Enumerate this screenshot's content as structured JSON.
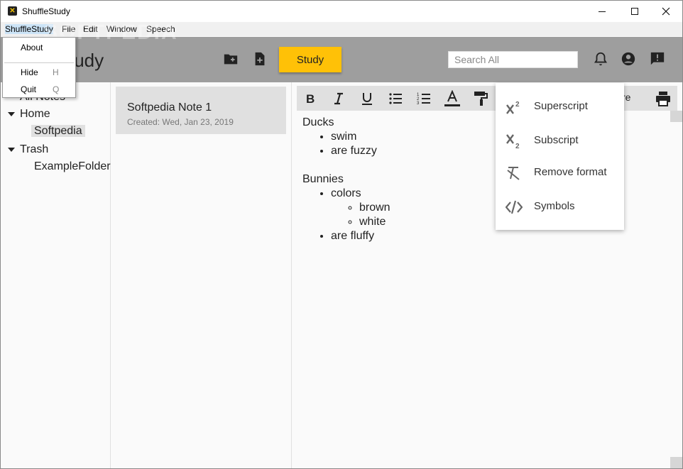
{
  "window": {
    "title": "ShuffleStudy"
  },
  "watermark": "SOFTPEDIA",
  "menubar": [
    "ShuffleStudy",
    "File",
    "Edit",
    "Window",
    "Speech"
  ],
  "app_menu": [
    {
      "label": "About",
      "key": ""
    },
    {
      "label": "Hide",
      "key": "H"
    },
    {
      "label": "Quit",
      "key": "Q"
    }
  ],
  "header": {
    "logo_visible": "tudy",
    "study_label": "Study",
    "search_placeholder": "Search All"
  },
  "sidebar": {
    "all_notes": "All Notes",
    "items": [
      {
        "label": "Home",
        "expanded": true
      },
      {
        "label": "Softpedia",
        "selected": true
      },
      {
        "label": "Trash",
        "expanded": true
      },
      {
        "label": "ExampleFolder"
      }
    ]
  },
  "notes": [
    {
      "title": "Softpedia Note 1",
      "created": "Created: Wed, Jan 23, 2019"
    }
  ],
  "toolbar": {
    "cut_text": "re"
  },
  "content": {
    "heading1": "Ducks",
    "list1": [
      "swim",
      "are fuzzy"
    ],
    "heading2": "Bunnies",
    "list2_item1": "colors",
    "list2_sub": [
      "brown",
      "white"
    ],
    "list2_item2": "are fluffy"
  },
  "format_menu": [
    {
      "label": "Superscript",
      "icon": "superscript-icon"
    },
    {
      "label": "Subscript",
      "icon": "subscript-icon"
    },
    {
      "label": "Remove format",
      "icon": "clear-format-icon"
    },
    {
      "label": "Symbols",
      "icon": "code-icon"
    }
  ],
  "colors": {
    "accent": "#ffc107",
    "header": "#9e9e9e"
  }
}
